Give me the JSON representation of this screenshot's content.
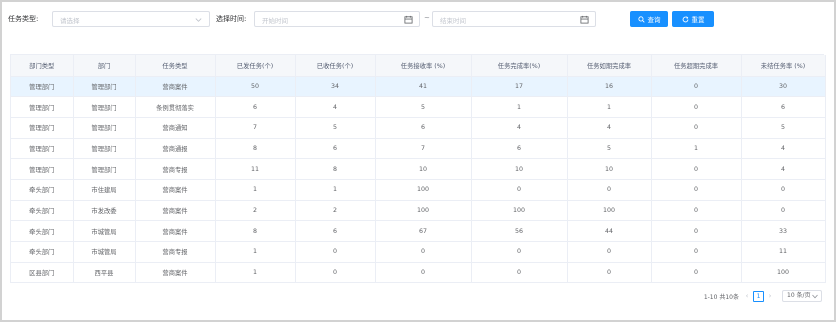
{
  "filter": {
    "task_type_label": "任务类型:",
    "task_type_placeholder": "请选择",
    "time_label": "选择时间:",
    "start_placeholder": "开始时间",
    "range_sep": "~",
    "end_placeholder": "结束时间",
    "query_label": "查询",
    "reset_label": "重置"
  },
  "table": {
    "columns": [
      "部门类型",
      "部门",
      "任务类型",
      "已发任务(个)",
      "已收任务(个)",
      "任务接收率 (%)",
      "任务完成率(%)",
      "任务如期完成率",
      "任务超期完成率",
      "未结任务率 (%)"
    ],
    "rows": [
      [
        "管理部门",
        "管理部门",
        "营商案件",
        "50",
        "34",
        "41",
        "17",
        "16",
        "0",
        "30"
      ],
      [
        "管理部门",
        "管理部门",
        "条例贯彻落实",
        "6",
        "4",
        "5",
        "1",
        "1",
        "0",
        "6"
      ],
      [
        "管理部门",
        "管理部门",
        "营商通知",
        "7",
        "5",
        "6",
        "4",
        "4",
        "0",
        "5"
      ],
      [
        "管理部门",
        "管理部门",
        "营商通报",
        "8",
        "6",
        "7",
        "6",
        "5",
        "1",
        "4"
      ],
      [
        "管理部门",
        "管理部门",
        "营商专报",
        "11",
        "8",
        "10",
        "10",
        "10",
        "0",
        "4"
      ],
      [
        "牵头部门",
        "市住建局",
        "营商案件",
        "1",
        "1",
        "100",
        "0",
        "0",
        "0",
        "0"
      ],
      [
        "牵头部门",
        "市发改委",
        "营商案件",
        "2",
        "2",
        "100",
        "100",
        "100",
        "0",
        "0"
      ],
      [
        "牵头部门",
        "市城管局",
        "营商案件",
        "8",
        "6",
        "67",
        "56",
        "44",
        "0",
        "33"
      ],
      [
        "牵头部门",
        "市城管局",
        "营商专报",
        "1",
        "0",
        "0",
        "0",
        "0",
        "0",
        "11"
      ],
      [
        "区县部门",
        "西平县",
        "营商案件",
        "1",
        "0",
        "0",
        "0",
        "0",
        "0",
        "100"
      ]
    ]
  },
  "pagination": {
    "total_text": "1-10 共10条",
    "prev": "‹",
    "current_page": "1",
    "next": "›",
    "page_size": "10 条/页"
  },
  "colors": {
    "primary": "#1890ff",
    "row_highlight": "#e8f4ff",
    "header_bg": "#f5f7fa"
  }
}
